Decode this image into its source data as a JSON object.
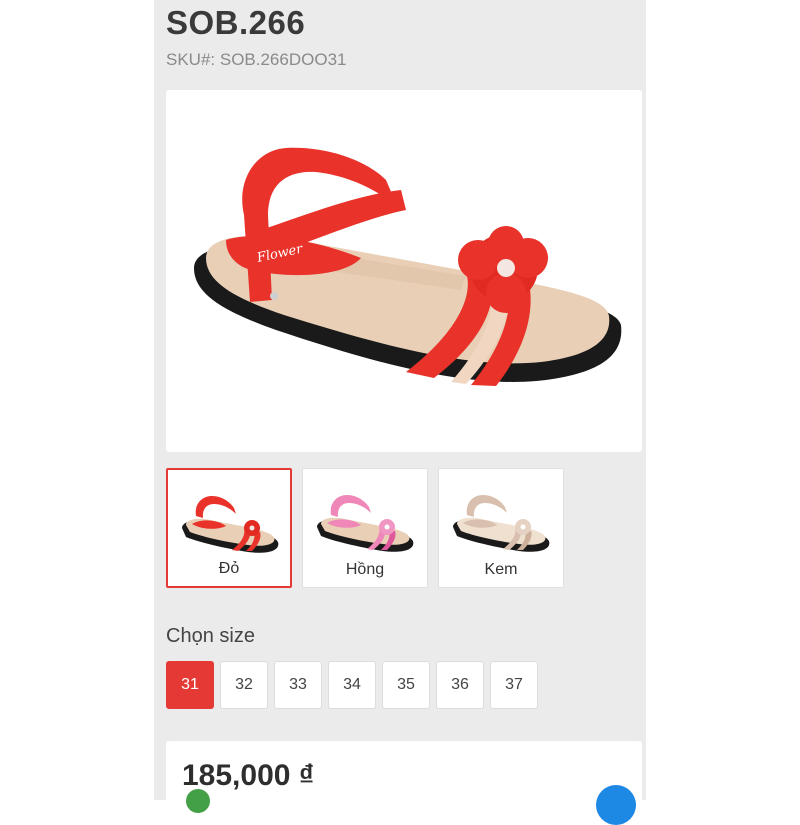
{
  "product": {
    "title": "SOB.266",
    "sku": "SKU#: SOB.266DOO31",
    "image_icon": "sandal-image",
    "brand_on_strap": "Flower"
  },
  "colors": {
    "accent": "#e53935",
    "variant_red": "#e8322a",
    "variant_pink": "#ef87b8",
    "variant_cream": "#e6d2c2"
  },
  "variants": [
    {
      "label": "Đỏ",
      "selected": true
    },
    {
      "label": "Hồng",
      "selected": false
    },
    {
      "label": "Kem",
      "selected": false
    }
  ],
  "size_picker": {
    "label": "Chọn size",
    "options": [
      "31",
      "32",
      "33",
      "34",
      "35",
      "36",
      "37"
    ],
    "selected": "31"
  },
  "price": {
    "value": "185,000 ₫"
  }
}
